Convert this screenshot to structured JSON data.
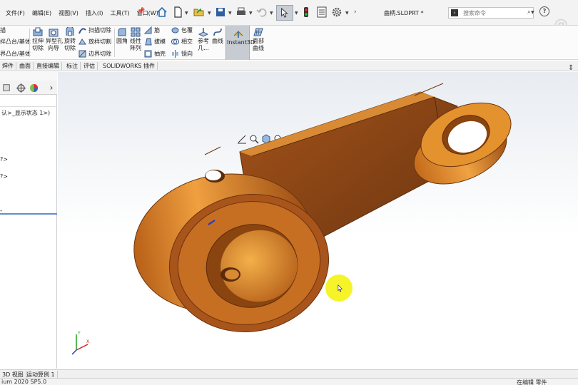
{
  "menu": [
    "文件(F)",
    "编辑(E)",
    "视图(V)",
    "插入(I)",
    "工具(T)",
    "窗口(W)"
  ],
  "document_title": "曲柄.SLDPRT *",
  "search": {
    "cmd_icon": "cmd-icon",
    "placeholder": "搜索命令"
  },
  "help_label": "?",
  "watermark": "@ 上",
  "command_manager": {
    "left_labels": [
      "描",
      "拌凸台/基体",
      "界凸台/基体"
    ],
    "tools": [
      {
        "label": "拉伸\n切除",
        "icon": "extruded-cut-icon"
      },
      {
        "label": "异型孔\n向导",
        "icon": "hole-wizard-icon"
      },
      {
        "label": "旋转\n切除",
        "icon": "revolved-cut-icon"
      },
      {
        "label": "圆角",
        "icon": "fillet-icon"
      },
      {
        "label": "线性\n阵列",
        "icon": "linear-pattern-icon"
      },
      {
        "label": "参考\n几...",
        "icon": "reference-geometry-icon"
      },
      {
        "label": "曲线",
        "icon": "curves-icon"
      },
      {
        "label": "面部\n曲线",
        "icon": "face-curves-icon"
      }
    ],
    "small_tools": [
      {
        "label": "扫描切除",
        "icon": "swept-cut-icon"
      },
      {
        "label": "放样切割",
        "icon": "lofted-cut-icon"
      },
      {
        "label": "边界切除",
        "icon": "boundary-cut-icon"
      },
      {
        "label": "筋",
        "icon": "rib-icon"
      },
      {
        "label": "拔模",
        "icon": "draft-icon"
      },
      {
        "label": "抽壳",
        "icon": "shell-icon"
      },
      {
        "label": "包覆",
        "icon": "wrap-icon"
      },
      {
        "label": "相交",
        "icon": "intersect-icon"
      },
      {
        "label": "镜向",
        "icon": "mirror-icon"
      }
    ],
    "instant3d": "Instant3D"
  },
  "tabs": [
    "焊件",
    "曲面",
    "直接编辑",
    "标注",
    "评估",
    "SOLIDWORKS 插件"
  ],
  "tree": {
    "line1": "认>_显示状态 1>)",
    "line2": "?>",
    "line3": "?>"
  },
  "bottom_tabs": [
    "3D 视图",
    "运动算例 1"
  ],
  "status": {
    "left": "ium 2020 SP5.0",
    "right": "在编辑 零件"
  },
  "colors": {
    "part_orange": "#c8701a",
    "part_dark": "#7a3c10",
    "highlight_yellow": "#f7f32a"
  }
}
